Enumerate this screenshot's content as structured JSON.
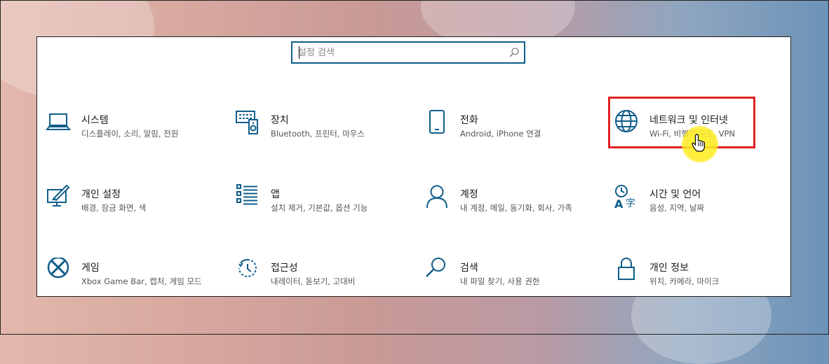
{
  "search": {
    "placeholder": "설정 검색"
  },
  "colors": {
    "accent": "#0f5e8a",
    "highlight": "#e02222",
    "cursor_halo": "#ffeb1e"
  },
  "tiles": [
    {
      "title": "시스템",
      "desc": "디스플레이, 소리, 알림, 전원",
      "icon": "laptop-icon"
    },
    {
      "title": "장치",
      "desc": "Bluetooth, 프린터, 마우스",
      "icon": "devices-icon"
    },
    {
      "title": "전화",
      "desc": "Android, iPhone 연결",
      "icon": "phone-icon"
    },
    {
      "title": "네트워크 및 인터넷",
      "desc": "Wi-Fi, 비행기 모드, VPN",
      "icon": "globe-icon"
    },
    {
      "title": "개인 설정",
      "desc": "배경, 잠금 화면, 색",
      "icon": "personalization-icon"
    },
    {
      "title": "앱",
      "desc": "설치 제거, 기본값, 옵션 기능",
      "icon": "apps-icon"
    },
    {
      "title": "계정",
      "desc": "내 계정, 메일, 동기화, 회사, 가족",
      "icon": "person-icon"
    },
    {
      "title": "시간 및 언어",
      "desc": "음성, 지역, 날짜",
      "icon": "time-language-icon"
    },
    {
      "title": "게임",
      "desc": "Xbox Game Bar, 캡처, 게임 모드",
      "icon": "xbox-icon"
    },
    {
      "title": "접근성",
      "desc": "내레이터, 돋보기, 고대비",
      "icon": "ease-of-access-icon"
    },
    {
      "title": "검색",
      "desc": "내 파일 찾기, 사용 권한",
      "icon": "search-icon"
    },
    {
      "title": "개인 정보",
      "desc": "위치, 카메라, 마이크",
      "icon": "lock-icon"
    }
  ]
}
